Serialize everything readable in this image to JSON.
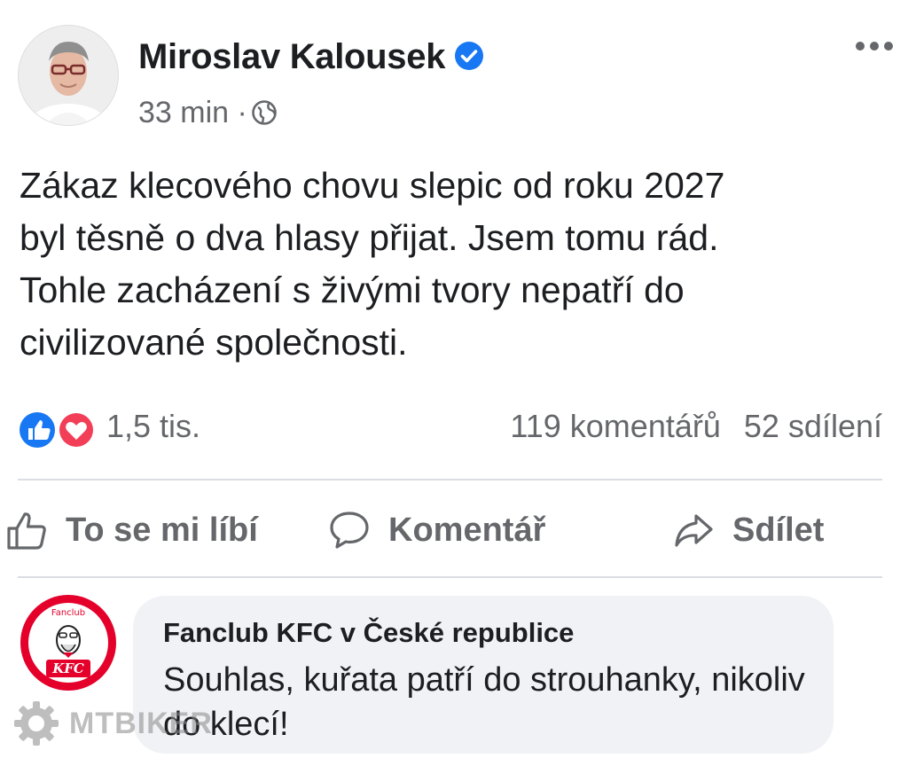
{
  "post": {
    "author": "Miroslav Kalousek",
    "time": "33 min",
    "separator": "·",
    "text": "Zákaz klecového chovu slepic od roku 2027\nbyl těsně o dva hlasy přijat. Jsem tomu rád.\nTohle zacházení s živými tvory nepatří do\ncivilizované společnosti.",
    "icons": {
      "verified": "verified-badge-icon",
      "audience": "globe-icon",
      "menu": "more-options-icon"
    }
  },
  "stats": {
    "reaction_count": "1,5 tis.",
    "comments": "119 komentářů",
    "shares": "52 sdílení",
    "reactions": [
      "like",
      "love"
    ]
  },
  "actions": {
    "like_label": "To se mi líbí",
    "comment_label": "Komentář",
    "share_label": "Sdílet"
  },
  "comment": {
    "author": "Fanclub KFC v České republice",
    "text": "Souhlas, kuřata patří do strouhanky, nikoliv do klecí!",
    "avatar_text": "KFC",
    "avatar_small_text": "Fanclub"
  },
  "watermark": {
    "text": "MTBIKER"
  },
  "colors": {
    "facebook_blue": "#1877f2",
    "love_red": "#f33e58",
    "kfc_red": "#e4002b",
    "secondary_text": "#65676b",
    "bubble_bg": "#f0f2f5"
  }
}
